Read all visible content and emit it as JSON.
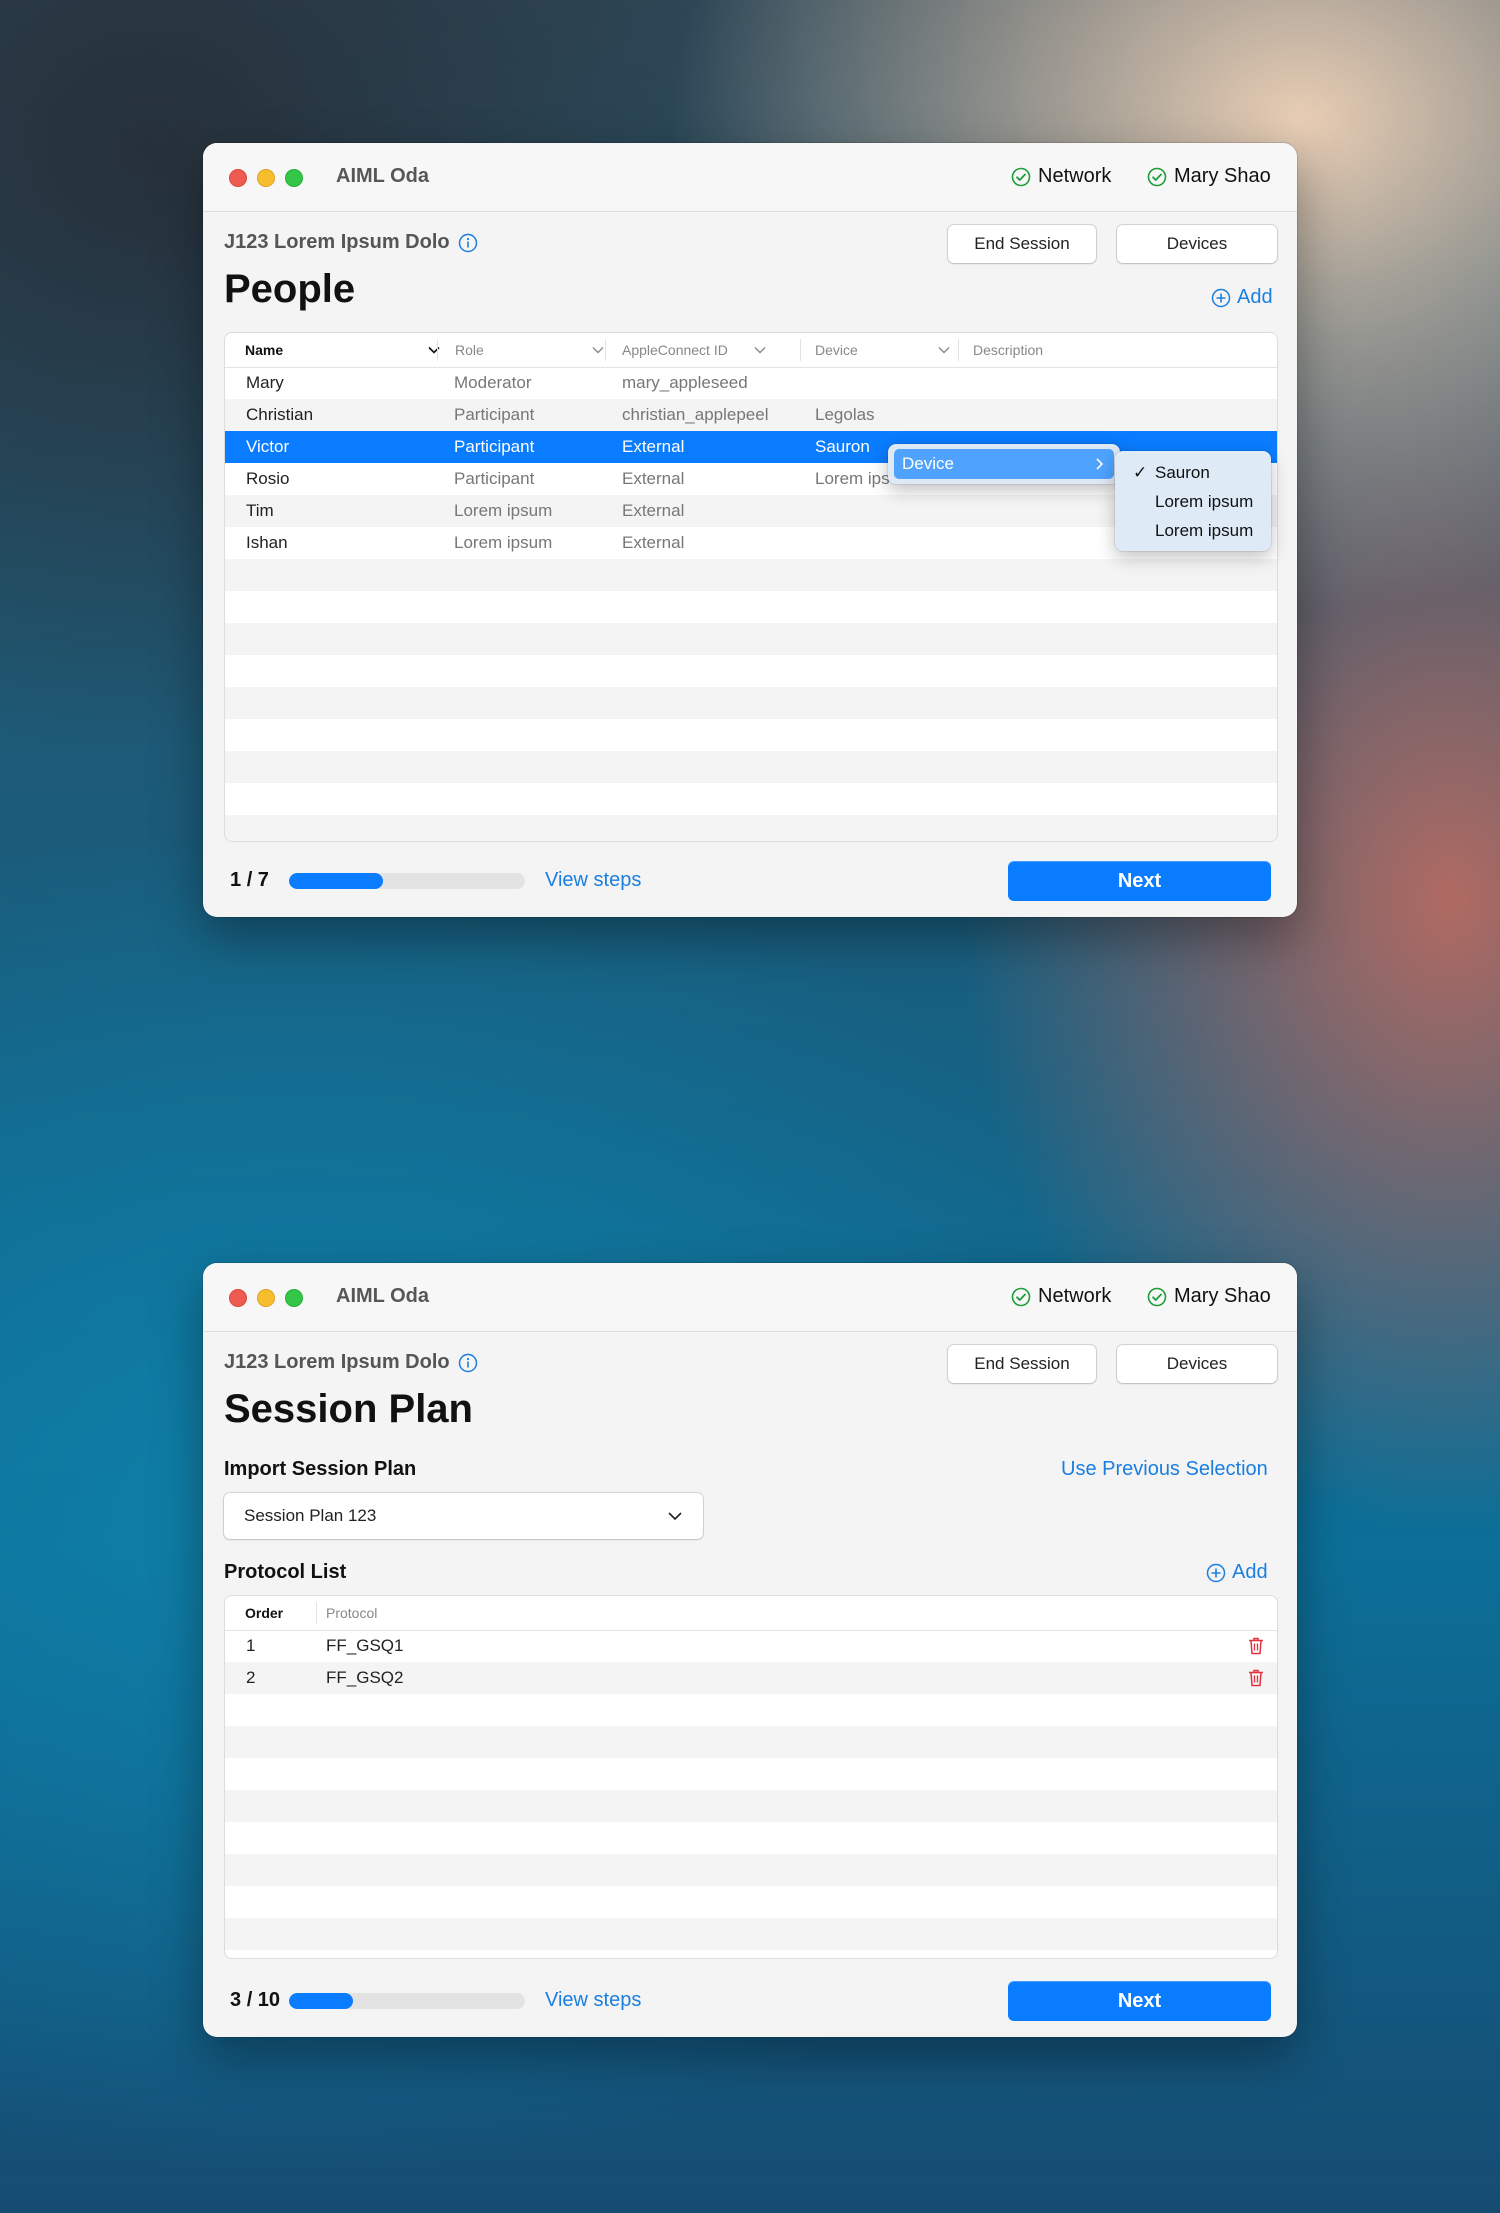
{
  "app_title": "AIML Oda",
  "status": {
    "network": "Network",
    "user": "Mary Shao"
  },
  "session_id": "J123 Lorem Ipsum Dolo",
  "buttons": {
    "end_session": "End Session",
    "devices": "Devices",
    "next": "Next",
    "add": "Add",
    "view_steps": "View steps"
  },
  "colors": {
    "accent": "#0a7cff",
    "success": "#1e9e3a",
    "danger": "#e0333d"
  },
  "people": {
    "title": "People",
    "columns": [
      "Name",
      "Role",
      "AppleConnect ID",
      "Device",
      "Description"
    ],
    "rows": [
      {
        "name": "Mary",
        "role": "Moderator",
        "id": "mary_appleseed",
        "device": ""
      },
      {
        "name": "Christian",
        "role": "Participant",
        "id": "christian_applepeel",
        "device": "Legolas"
      },
      {
        "name": "Victor",
        "role": "Participant",
        "id": "External",
        "device": "Sauron"
      },
      {
        "name": "Rosio",
        "role": "Participant",
        "id": "External",
        "device": "Lorem ips"
      },
      {
        "name": "Tim",
        "role": "Lorem ipsum",
        "id": "External",
        "device": ""
      },
      {
        "name": "Ishan",
        "role": "Lorem ipsum",
        "id": "External",
        "device": ""
      }
    ],
    "selected_row": "Victor",
    "context_menu": {
      "item": "Device",
      "submenu": [
        {
          "label": "Sauron",
          "checked": true
        },
        {
          "label": "Lorem ipsum",
          "checked": false
        },
        {
          "label": "Lorem ipsum",
          "checked": false
        }
      ]
    },
    "step": {
      "current": "1",
      "total": "/ 7",
      "progress": 0.4
    }
  },
  "session_plan": {
    "title": "Session Plan",
    "import_label": "Import Session Plan",
    "use_previous": "Use Previous Selection",
    "selected_plan": "Session Plan 123",
    "protocol_label": "Protocol List",
    "columns": [
      "Order",
      "Protocol"
    ],
    "rows": [
      {
        "order": "1",
        "protocol": "FF_GSQ1"
      },
      {
        "order": "2",
        "protocol": "FF_GSQ2"
      }
    ],
    "step": {
      "current": "3",
      "total": "/ 10",
      "progress": 0.27
    }
  }
}
